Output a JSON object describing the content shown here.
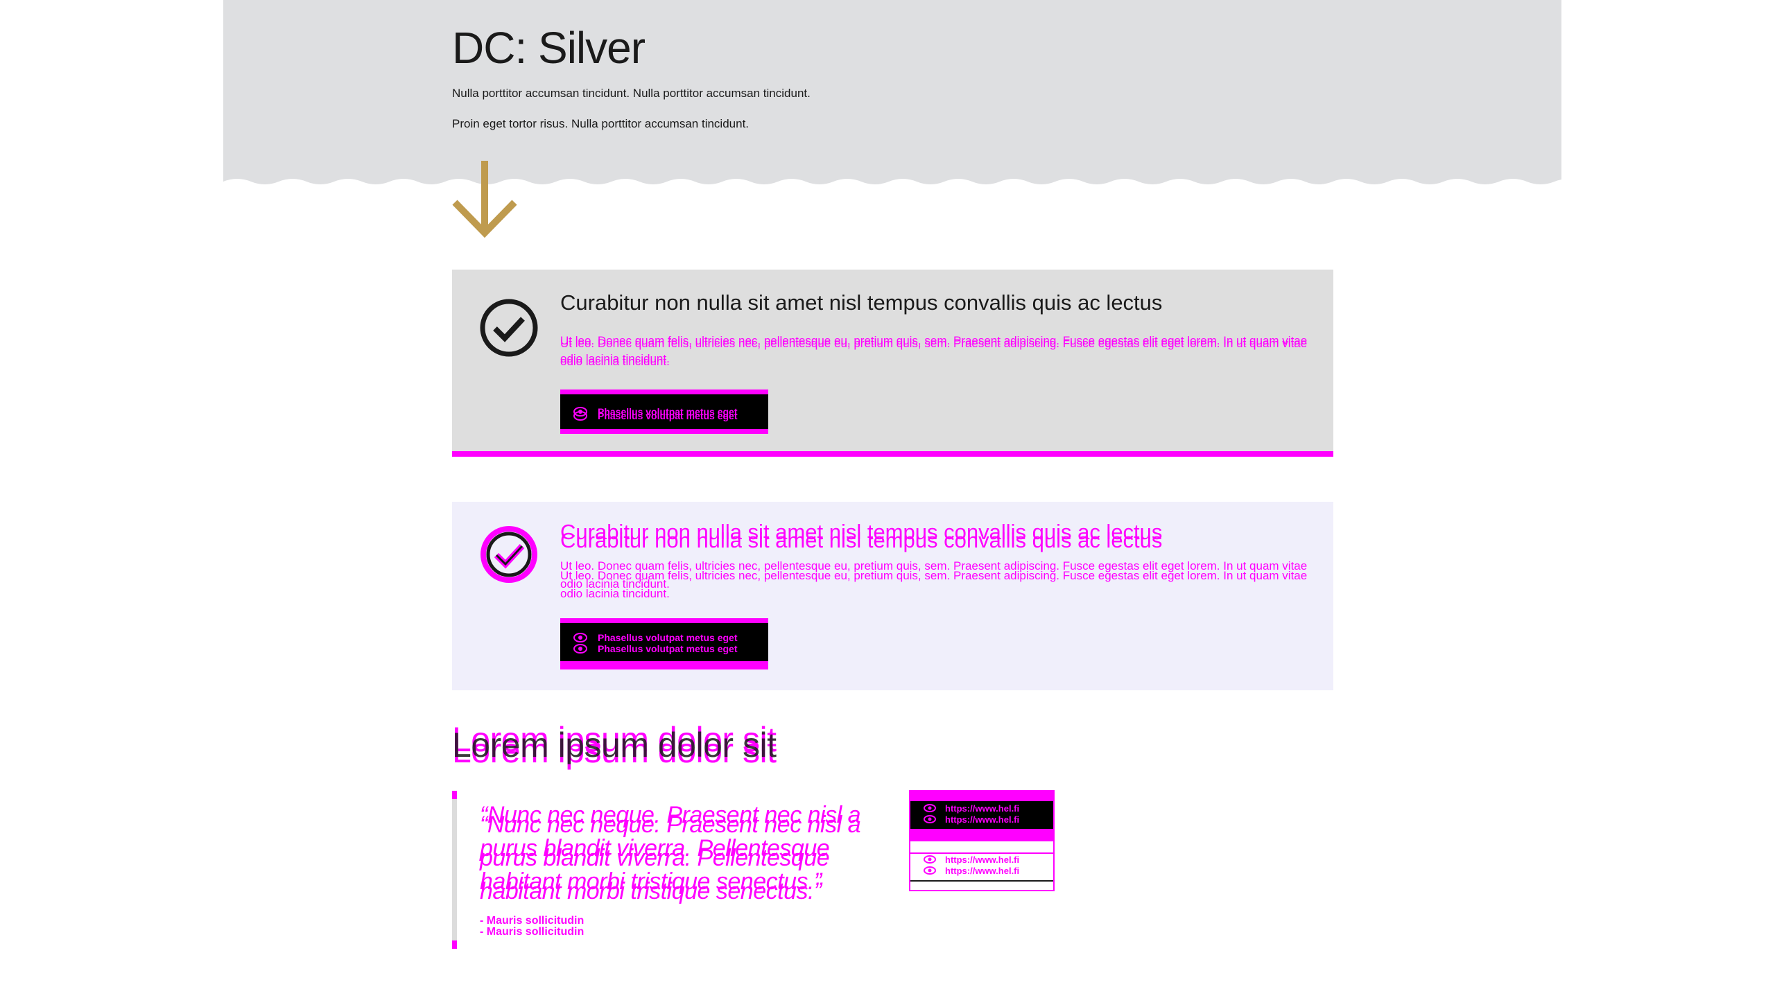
{
  "hero": {
    "title": "DC: Silver",
    "line1": "Nulla porttitor accumsan tincidunt. Nulla porttitor accumsan tincidunt.",
    "line2": "Proin eget tortor risus. Nulla porttitor accumsan tincidunt."
  },
  "cards": [
    {
      "title": "Curabitur non nulla sit amet nisl tempus convallis quis ac lectus",
      "text": "Ut leo. Donec quam felis, ultricies nec, pellentesque eu, pretium quis, sem. Praesent adipiscing. Fusce egestas elit eget lorem. In ut quam vitae odio lacinia tincidunt.",
      "button_label": "Phasellus volutpat metus eget"
    },
    {
      "title": "Curabitur non nulla sit amet nisl tempus convallis quis ac lectus",
      "text": "Ut leo. Donec quam felis, ultricies nec, pellentesque eu, pretium quis, sem. Praesent adipiscing. Fusce egestas elit eget lorem. In ut quam vitae odio lacinia tincidunt.",
      "button_label": "Phasellus volutpat metus eget"
    }
  ],
  "section": {
    "title": "Lorem ipsum dolor sit",
    "quote": "“Nunc nec neque. Praesent nec nisl a purus blandit viverra. Pellentesque habitant morbi tristique senectus.”",
    "author": "- Mauris sollicitudin"
  },
  "links": {
    "url": "https://www.hel.fi"
  },
  "colors": {
    "accent": "#ff00ff",
    "hero_bg": "#dedfe1",
    "arrow": "#bf9b4e",
    "card1_bg": "#dedede",
    "card2_bg": "#f0effb"
  }
}
